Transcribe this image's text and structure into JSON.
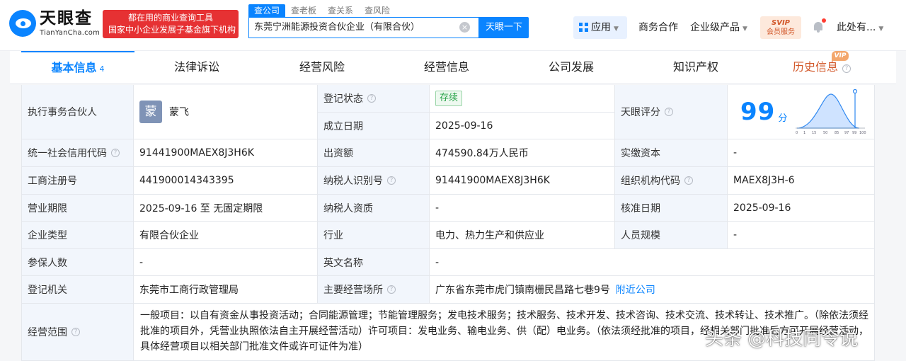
{
  "header": {
    "logo": {
      "cn": "天眼查",
      "en": "TianYanCha.com"
    },
    "slogan": {
      "line1": "都在用的商业查询工具",
      "line2": "国家中小企业发展子基金旗下机构"
    },
    "search_tabs": [
      "查公司",
      "查老板",
      "查关系",
      "查风险"
    ],
    "search_value": "东莞宁洲能源投资合伙企业（有限合伙）",
    "search_button": "天眼一下",
    "apps_label": "应用",
    "nav": [
      "商务合作",
      "企业级产品"
    ],
    "svip": {
      "line1": "SVIP",
      "line2": "会员服务"
    },
    "user": "此处有..."
  },
  "tabs": [
    {
      "label": "基本信息",
      "count": "4"
    },
    {
      "label": "法律诉讼"
    },
    {
      "label": "经营风险"
    },
    {
      "label": "经营信息"
    },
    {
      "label": "公司发展"
    },
    {
      "label": "知识产权"
    },
    {
      "label": "历史信息",
      "badge": "VIP"
    }
  ],
  "info": {
    "partner_label": "执行事务合伙人",
    "partner_avatar": "蒙",
    "partner_name": "蒙飞",
    "status_label": "登记状态",
    "status_value": "存续",
    "established_label": "成立日期",
    "established_value": "2025-09-16",
    "score_label": "天眼评分",
    "score_value": "99",
    "score_unit": "分",
    "score_axis": [
      "0",
      "1",
      "15",
      "50",
      "85",
      "97",
      "99",
      "100"
    ],
    "credit_code_label": "统一社会信用代码",
    "credit_code_value": "91441900MAEX8J3H6K",
    "capital_label": "出资额",
    "capital_value": "474590.84万人民币",
    "paid_label": "实缴资本",
    "paid_value": "-",
    "reg_no_label": "工商注册号",
    "reg_no_value": "441900014343395",
    "taxpayer_id_label": "纳税人识别号",
    "taxpayer_id_value": "91441900MAEX8J3H6K",
    "org_code_label": "组织机构代码",
    "org_code_value": "MAEX8J3H-6",
    "term_label": "营业期限",
    "term_value": "2025-09-16 至 无固定期限",
    "taxpayer_qual_label": "纳税人资质",
    "taxpayer_qual_value": "-",
    "approval_label": "核准日期",
    "approval_value": "2025-09-16",
    "type_label": "企业类型",
    "type_value": "有限合伙企业",
    "industry_label": "行业",
    "industry_value": "电力、热力生产和供应业",
    "staff_label": "人员规模",
    "staff_value": "-",
    "insured_label": "参保人数",
    "insured_value": "-",
    "english_label": "英文名称",
    "english_value": "-",
    "authority_label": "登记机关",
    "authority_value": "东莞市工商行政管理局",
    "address_label": "主要经营场所",
    "address_value": "广东省东莞市虎门镇南栅民昌路七巷9号",
    "nearby_link": "附近公司",
    "scope_label": "经营范围",
    "scope_value": "一般项目：以自有资金从事投资活动；合同能源管理；节能管理服务；发电技术服务；技术服务、技术开发、技术咨询、技术交流、技术转让、技术推广。（除依法须经批准的项目外，凭营业执照依法自主开展经营活动）许可项目：发电业务、输电业务、供（配）电业务。（依法须经批准的项目，经相关部门批准后方可开展经营活动，具体经营项目以相关部门批准文件或许可证件为准）"
  },
  "watermark": "头条 @科技同令说",
  "colors": {
    "accent": "#0a84ff",
    "label_bg": "#f2f6fc",
    "status_green": "#27a348",
    "history": "#d2582a"
  }
}
